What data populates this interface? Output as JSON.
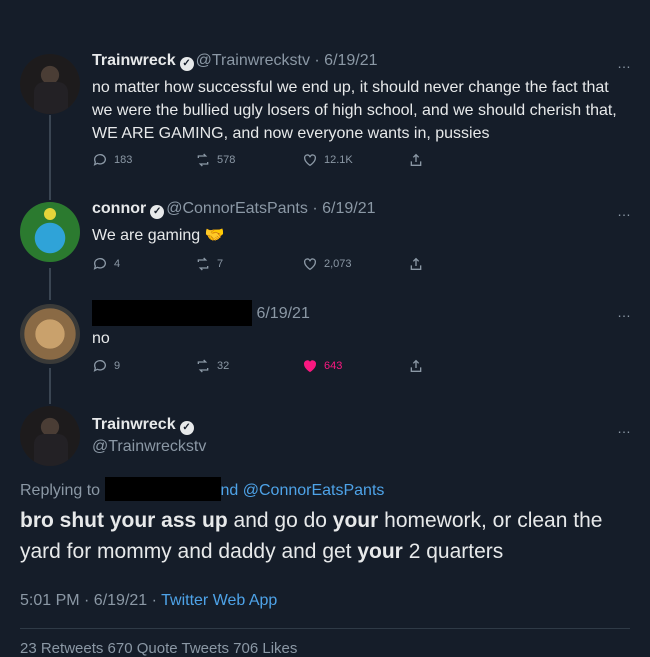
{
  "tweets": [
    {
      "name": "Trainwreck",
      "handle": "@Trainwreckstv",
      "date": "· 6/19/21",
      "text": "no matter how successful we end up, it should never change the fact that we were the bullied ugly losers of high school, and we should cherish that, WE ARE GAMING, and now everyone wants in, pussies",
      "replies": "183",
      "retweets": "578",
      "likes": "12.1K"
    },
    {
      "name": "connor",
      "handle": "@ConnorEatsPants",
      "date": "· 6/19/21",
      "text": "We are gaming 🤝",
      "replies": "4",
      "retweets": "7",
      "likes": "2,073"
    },
    {
      "date": "6/19/21",
      "text": "no",
      "replies": "9",
      "retweets": "32",
      "likes": "643"
    }
  ],
  "main": {
    "name": "Trainwreck",
    "handle": "@Trainwreckstv",
    "replying_prefix": "Replying to",
    "replying_suffix": "nd @ConnorEatsPants",
    "text_parts": [
      "bro shut your ass up",
      " and go do ",
      "your",
      " homework, or clean the yard for mommy and daddy and get ",
      "your",
      " 2 quarters"
    ],
    "time": "5:01 PM · 6/19/21 · ",
    "app": "Twitter Web App",
    "counts_text": "23 Retweets  670 Quote Tweets  706 Likes"
  },
  "more_icon": "…",
  "colors": {
    "background": "#151d29",
    "link": "#4ea3e8",
    "like_active": "#f91880",
    "muted": "#8b98a5"
  }
}
